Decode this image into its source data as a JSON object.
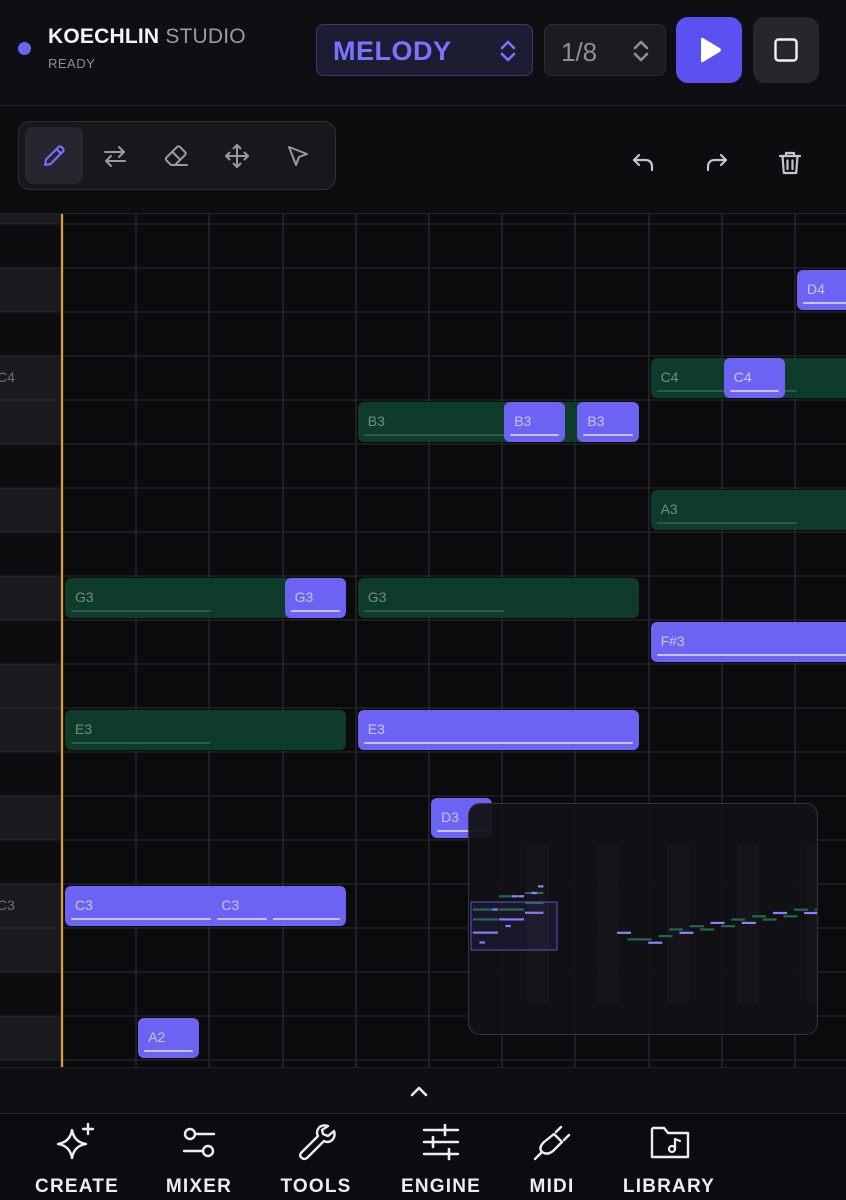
{
  "header": {
    "brand": "KOECHLIN",
    "brand_suffix": "STUDIO",
    "status": "READY",
    "track_select": "MELODY",
    "quantize_select": "1/8",
    "accent": "#5b50f0"
  },
  "toolbar": {
    "tools": [
      {
        "name": "draw",
        "icon": "pencil-icon",
        "active": true
      },
      {
        "name": "transpose",
        "icon": "swap-arrows-icon",
        "active": false
      },
      {
        "name": "erase",
        "icon": "eraser-icon",
        "active": false
      },
      {
        "name": "move",
        "icon": "move-arrows-icon",
        "active": false
      },
      {
        "name": "select",
        "icon": "pointer-icon",
        "active": false
      }
    ],
    "actions": [
      {
        "name": "undo",
        "icon": "undo-icon"
      },
      {
        "name": "redo",
        "icon": "redo-icon"
      },
      {
        "name": "delete",
        "icon": "trash-icon"
      }
    ]
  },
  "piano_roll": {
    "row_labels": [
      {
        "text": "C4",
        "pitch": "C4"
      },
      {
        "text": "C3",
        "pitch": "C3"
      }
    ],
    "notes": [
      {
        "label": "D4",
        "pitch": "D4",
        "step": 10,
        "length": 1,
        "selected": true
      },
      {
        "label": "C4",
        "pitch": "C4",
        "step": 8,
        "length": 3,
        "selected": false
      },
      {
        "label": "C4",
        "pitch": "C4",
        "step": 9,
        "length": 1,
        "selected": true
      },
      {
        "label": "B3",
        "pitch": "B3",
        "step": 4,
        "length": 4,
        "selected": false
      },
      {
        "label": "B3",
        "pitch": "B3",
        "step": 6,
        "length": 1,
        "selected": true
      },
      {
        "label": "B3",
        "pitch": "B3",
        "step": 7,
        "length": 1,
        "selected": true
      },
      {
        "label": "A3",
        "pitch": "A3",
        "step": 8,
        "length": 3,
        "selected": false
      },
      {
        "label": "G3",
        "pitch": "G3",
        "step": 0,
        "length": 4,
        "selected": false
      },
      {
        "label": "G3",
        "pitch": "G3",
        "step": 3,
        "length": 1,
        "selected": true
      },
      {
        "label": "G3",
        "pitch": "G3",
        "step": 4,
        "length": 4,
        "selected": false
      },
      {
        "label": "F#3",
        "pitch": "F#3",
        "step": 8,
        "length": 3,
        "selected": true
      },
      {
        "label": "E3",
        "pitch": "E3",
        "step": 0,
        "length": 4,
        "selected": false
      },
      {
        "label": "E3",
        "pitch": "E3",
        "step": 4,
        "length": 4,
        "selected": true
      },
      {
        "label": "D3",
        "pitch": "D3",
        "step": 5,
        "length": 1,
        "selected": true
      },
      {
        "label": "C3",
        "pitch": "C3",
        "step": 0,
        "length": 4,
        "selected": true
      },
      {
        "label": "C3",
        "pitch": "C3",
        "step": 2,
        "length": 1,
        "selected": true
      },
      {
        "label": "A2",
        "pitch": "A2",
        "step": 1,
        "length": 1,
        "selected": true
      }
    ],
    "note_colors": {
      "ghost": "#0e3b2a",
      "selected": "#6c63f2",
      "playhead": "#e5a21a"
    }
  },
  "bottom_nav": [
    {
      "label": "CREATE",
      "icon": "sparkle-icon"
    },
    {
      "label": "MIXER",
      "icon": "sliders-icon"
    },
    {
      "label": "TOOLS",
      "icon": "wrench-icon"
    },
    {
      "label": "ENGINE",
      "icon": "equalizer-icon"
    },
    {
      "label": "MIDI",
      "icon": "plug-icon"
    },
    {
      "label": "LIBRARY",
      "icon": "music-folder-icon"
    }
  ]
}
